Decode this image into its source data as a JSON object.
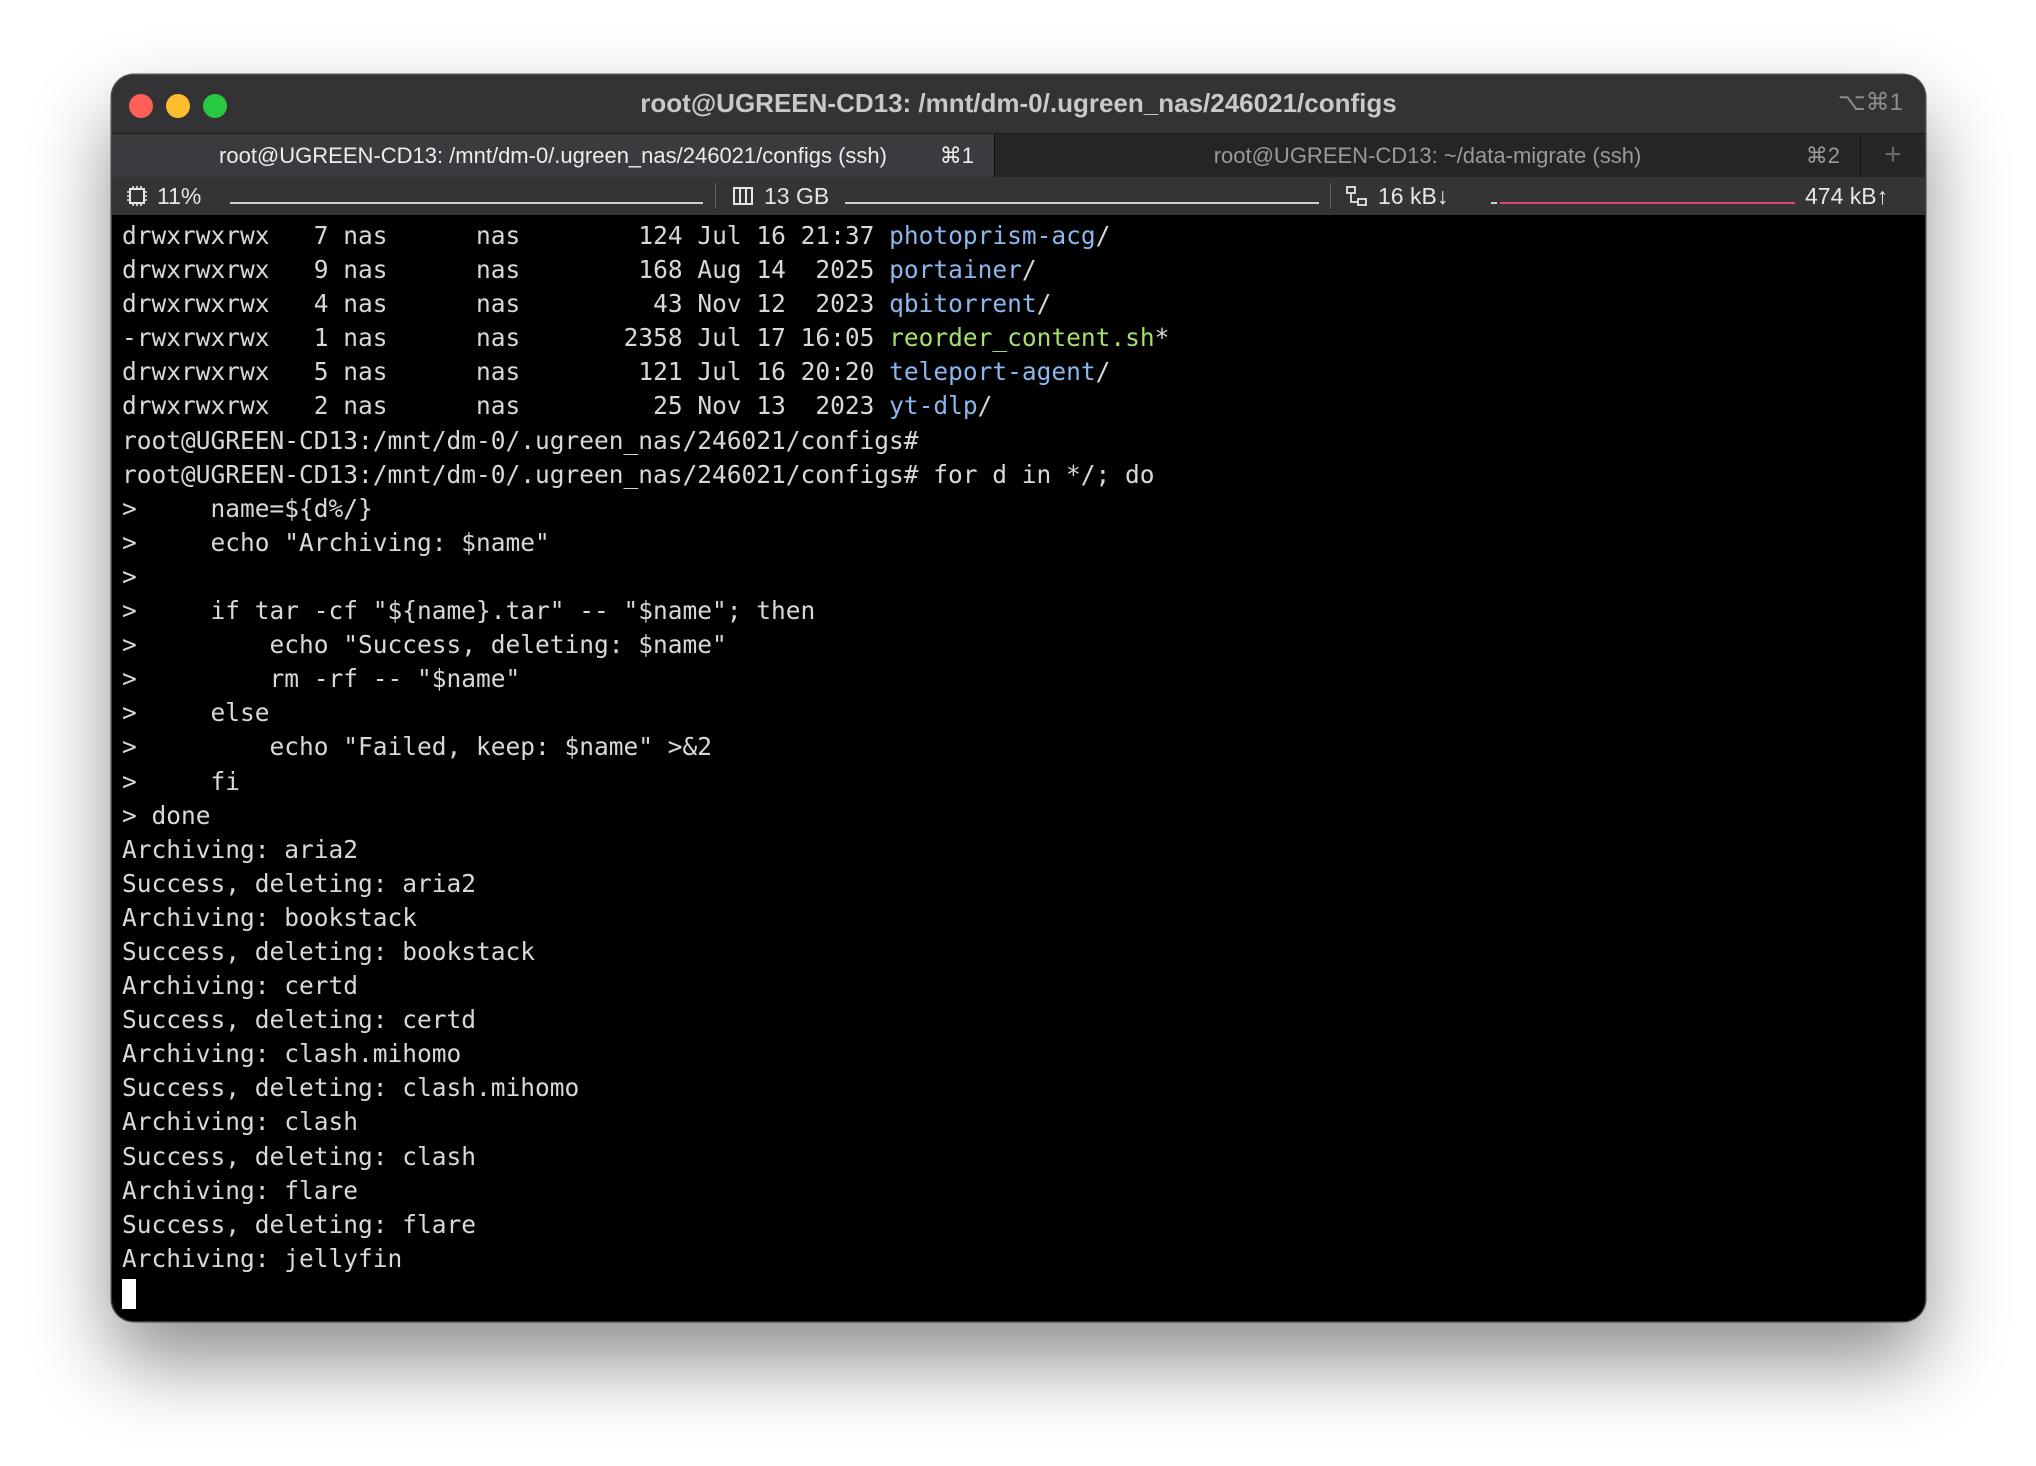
{
  "window": {
    "title": "root@UGREEN-CD13: /mnt/dm-0/.ugreen_nas/246021/configs",
    "shortcut": "⌥⌘1"
  },
  "tabs": [
    {
      "label": "root@UGREEN-CD13: /mnt/dm-0/.ugreen_nas/246021/configs (ssh)",
      "shortcut": "⌘1",
      "active": true
    },
    {
      "label": "root@UGREEN-CD13: ~/data-migrate (ssh)",
      "shortcut": "⌘2",
      "active": false
    }
  ],
  "new_tab_label": "+",
  "status": {
    "cpu": "11%",
    "memory": "13 GB",
    "net_down": "16 kB↓",
    "net_up": "474 kB↑",
    "colors": {
      "cpu_graph": "#cfcfcf",
      "mem_graph": "#cfcfcf",
      "net_down_graph": "#cfcfcf",
      "net_up_graph": "#e0457b"
    }
  },
  "listing": [
    {
      "perms": "drwxrwxrwx",
      "links": "7",
      "owner": "nas",
      "group": "nas",
      "size": "124",
      "date": "Jul 16 21:37",
      "name": "photoprism-acg",
      "suffix": "/",
      "kind": "dir"
    },
    {
      "perms": "drwxrwxrwx",
      "links": "9",
      "owner": "nas",
      "group": "nas",
      "size": "168",
      "date": "Aug 14  2025",
      "name": "portainer",
      "suffix": "/",
      "kind": "dir"
    },
    {
      "perms": "drwxrwxrwx",
      "links": "4",
      "owner": "nas",
      "group": "nas",
      "size": "43",
      "date": "Nov 12  2023",
      "name": "qbitorrent",
      "suffix": "/",
      "kind": "dir"
    },
    {
      "perms": "-rwxrwxrwx",
      "links": "1",
      "owner": "nas",
      "group": "nas",
      "size": "2358",
      "date": "Jul 17 16:05",
      "name": "reorder_content.sh",
      "suffix": "*",
      "kind": "exe"
    },
    {
      "perms": "drwxrwxrwx",
      "links": "5",
      "owner": "nas",
      "group": "nas",
      "size": "121",
      "date": "Jul 16 20:20",
      "name": "teleport-agent",
      "suffix": "/",
      "kind": "dir"
    },
    {
      "perms": "drwxrwxrwx",
      "links": "2",
      "owner": "nas",
      "group": "nas",
      "size": "25",
      "date": "Nov 13  2023",
      "name": "yt-dlp",
      "suffix": "/",
      "kind": "dir"
    }
  ],
  "output": [
    "root@UGREEN-CD13:/mnt/dm-0/.ugreen_nas/246021/configs#",
    "root@UGREEN-CD13:/mnt/dm-0/.ugreen_nas/246021/configs# for d in */; do",
    ">     name=${d%/}",
    ">     echo \"Archiving: $name\"",
    ">",
    ">     if tar -cf \"${name}.tar\" -- \"$name\"; then",
    ">         echo \"Success, deleting: $name\"",
    ">         rm -rf -- \"$name\"",
    ">     else",
    ">         echo \"Failed, keep: $name\" >&2",
    ">     fi",
    "> done",
    "Archiving: aria2",
    "Success, deleting: aria2",
    "Archiving: bookstack",
    "Success, deleting: bookstack",
    "Archiving: certd",
    "Success, deleting: certd",
    "Archiving: clash.mihomo",
    "Success, deleting: clash.mihomo",
    "Archiving: clash",
    "Success, deleting: clash",
    "Archiving: flare",
    "Success, deleting: flare",
    "Archiving: jellyfin"
  ],
  "theme": {
    "directory_color": "#8cb7ec",
    "executable_color": "#a6df6b",
    "text_color": "#d8d8d8",
    "background": "#000000"
  }
}
